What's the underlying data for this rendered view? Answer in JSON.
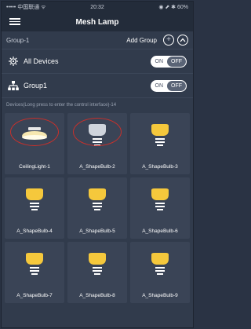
{
  "status_bar": {
    "carrier": "••••• 中国联通 ᯤ",
    "time": "20:32",
    "right": "◉ ⬈ ✱ 60%"
  },
  "header": {
    "title": "Mesh Lamp",
    "menu_icon": "menu-icon"
  },
  "group_bar": {
    "current": "Group-1",
    "add_label": "Add Group",
    "add_icon": "plus-circle-icon",
    "collapse_icon": "chevron-up-circle-icon"
  },
  "controls": [
    {
      "label": "All Devices",
      "icon": "gear-cluster-icon",
      "on": "ON",
      "off": "OFF"
    },
    {
      "label": "Group1",
      "icon": "network-icon",
      "on": "ON",
      "off": "OFF"
    }
  ],
  "hint": "Devices(Long press to enter the control interface)-14",
  "colors": {
    "lamp_on": "#f5c83c",
    "ceiling_on": "#f6e7b0",
    "off_bulb": "#cfd4dc",
    "highlight": "#c8302b"
  },
  "devices": [
    {
      "name": "CeilingLight-1",
      "kind": "ceiling",
      "state": "on"
    },
    {
      "name": "A_ShapeBulb-2",
      "kind": "bulb",
      "state": "off"
    },
    {
      "name": "A_ShapeBulb-3",
      "kind": "bulb",
      "state": "on"
    },
    {
      "name": "A_ShapeBulb-4",
      "kind": "bulb",
      "state": "on"
    },
    {
      "name": "A_ShapeBulb-5",
      "kind": "bulb",
      "state": "on"
    },
    {
      "name": "A_ShapeBulb-6",
      "kind": "bulb",
      "state": "on"
    },
    {
      "name": "A_ShapeBulb-7",
      "kind": "bulb",
      "state": "on"
    },
    {
      "name": "A_ShapeBulb-8",
      "kind": "bulb",
      "state": "on"
    },
    {
      "name": "A_ShapeBulb-9",
      "kind": "bulb",
      "state": "on"
    }
  ]
}
